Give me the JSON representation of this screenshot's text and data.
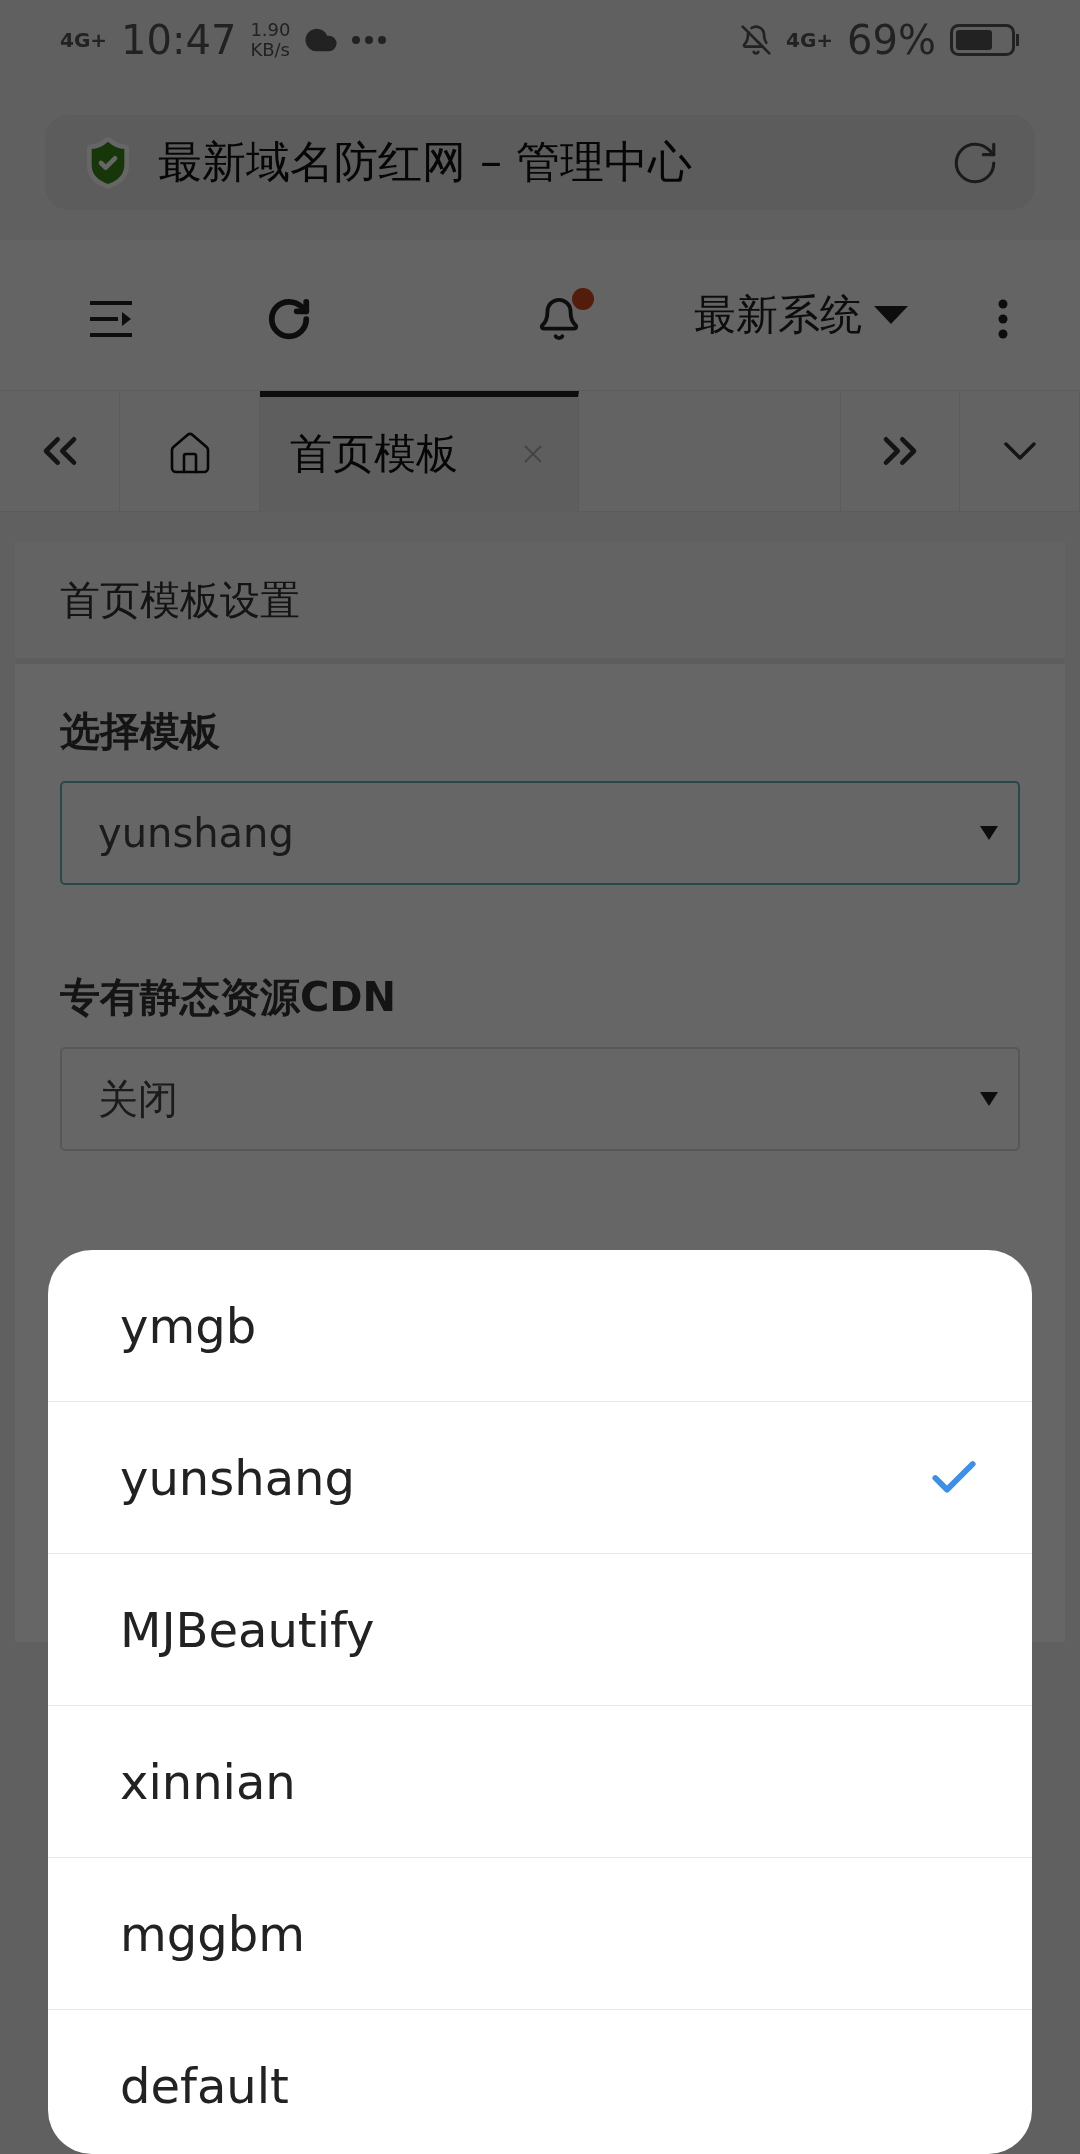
{
  "status_bar": {
    "network_left": "4G+",
    "time": "10:47",
    "speed_value": "1.90",
    "speed_unit": "KB/s",
    "network_right": "4G+",
    "battery": "69%"
  },
  "url_bar": {
    "title": "最新域名防红网 – 管理中心"
  },
  "header": {
    "notification_badge": true,
    "system_menu": "最新系统"
  },
  "tabs": [
    {
      "kind": "home",
      "selected": false
    },
    {
      "kind": "page",
      "label": "首页模板",
      "selected": true
    }
  ],
  "panel": {
    "title": "首页模板设置",
    "fields": [
      {
        "label": "选择模板",
        "value": "yunshang",
        "focused": true
      },
      {
        "label": "专有静态资源CDN",
        "value": "关闭",
        "focused": false
      }
    ]
  },
  "picker": {
    "options": [
      {
        "label": "ymgb",
        "selected": false
      },
      {
        "label": "yunshang",
        "selected": true
      },
      {
        "label": "MJBeautify",
        "selected": false
      },
      {
        "label": "xinnian",
        "selected": false
      },
      {
        "label": "mggbm",
        "selected": false
      },
      {
        "label": "default",
        "selected": false
      }
    ]
  }
}
